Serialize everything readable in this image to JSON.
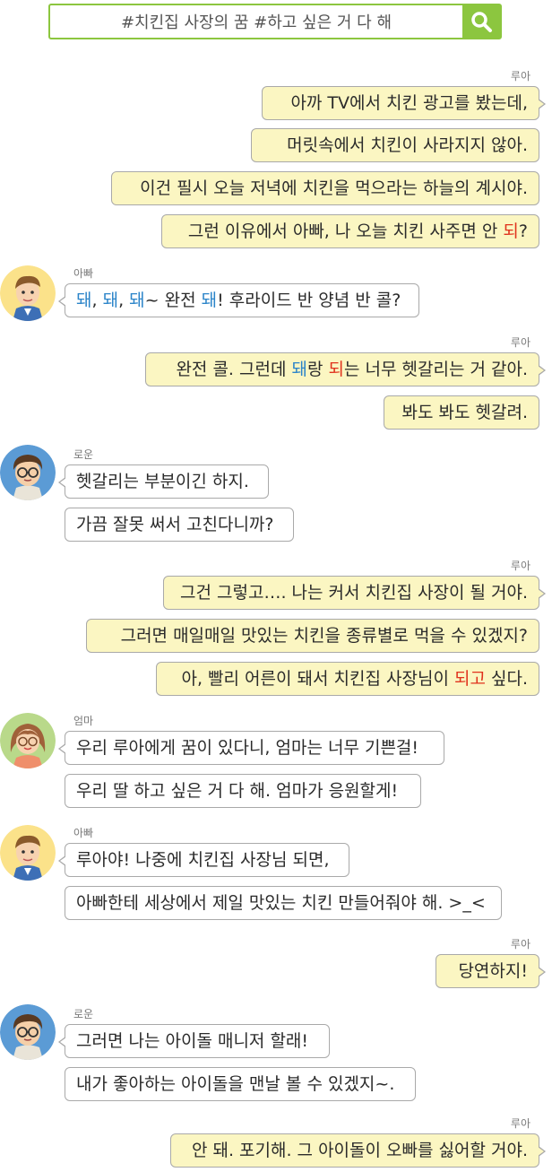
{
  "search": {
    "query": "#치킨집 사장의 꿈  #하고 싶은 거 다 해",
    "icon": "search-icon",
    "accent": "#8cc63f"
  },
  "colors": {
    "my_bubble": "#fbf6c2",
    "other_bubble": "#ffffff",
    "highlight_blue": "#2b84c9",
    "highlight_red": "#e0321d"
  },
  "chat": {
    "names": {
      "rua": "루아",
      "dad": "아빠",
      "rowoon": "로운",
      "mom": "엄마"
    },
    "m1": "아까 TV에서 치킨 광고를 봤는데,",
    "m2": "머릿속에서 치킨이 사라지지 않아.",
    "m3": "이건 필시 오늘 저녁에 치킨을 먹으라는 하늘의 계시야.",
    "m4": {
      "pre": "그런 이유에서 아빠, 나 오늘 치킨 사주면 안 ",
      "red": "되",
      "post": "?"
    },
    "m5": {
      "b1": "돼",
      "s1": ", ",
      "b2": "돼",
      "s2": ", ",
      "b3": "돼",
      "s3": "~ 완전 ",
      "b4": "돼",
      "post": "! 후라이드 반 양념 반 콜?"
    },
    "m6": {
      "pre": "완전 콜. 그런데 ",
      "blue": "돼",
      "mid": "랑 ",
      "red": "되",
      "post": "는 너무 헷갈리는 거 같아."
    },
    "m7": "봐도 봐도 헷갈려.",
    "m8": "헷갈리는 부분이긴 하지.",
    "m9": "가끔 잘못 써서 고친다니까?",
    "m10": "그건 그렇고…. 나는 커서 치킨집 사장이 될 거야.",
    "m11": "그러면 매일매일 맛있는 치킨을 종류별로 먹을 수 있겠지?",
    "m12": {
      "pre": "아, 빨리 어른이 돼서 치킨집 사장님이 ",
      "red": "되고",
      "post": " 싶다."
    },
    "m13": "우리 루아에게 꿈이 있다니, 엄마는 너무 기쁜걸!",
    "m14": "우리 딸 하고 싶은 거 다 해. 엄마가 응원할게!",
    "m15": "루아야! 나중에 치킨집 사장님 되면,",
    "m16": "아빠한테 세상에서 제일 맛있는 치킨 만들어줘야 해. >_<",
    "m17": "당연하지!",
    "m18": "그러면 나는 아이돌 매니저 할래!",
    "m19": "내가 좋아하는 아이돌을 맨날 볼 수 있겠지~.",
    "m20": "안 돼. 포기해. 그 아이돌이 오빠를 싫어할 거야."
  }
}
